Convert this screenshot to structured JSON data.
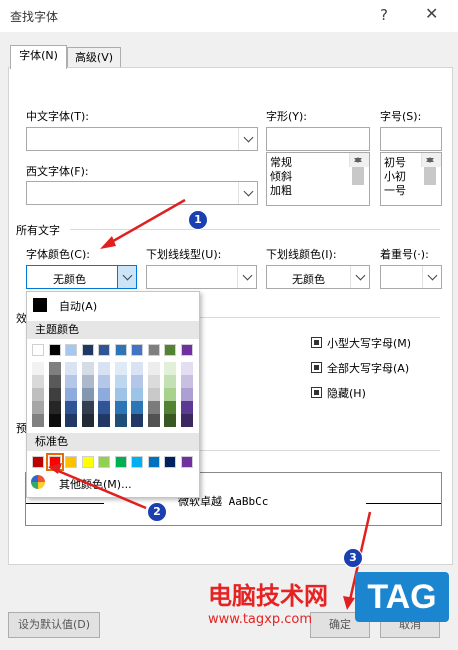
{
  "window": {
    "title": "查找字体",
    "help": "?",
    "close": "✕"
  },
  "tabs": [
    {
      "label": "字体(N)"
    },
    {
      "label": "高级(V)"
    }
  ],
  "font": {
    "chinese_label": "中文字体(T):",
    "western_label": "西文字体(F):",
    "style_label": "字形(Y):",
    "size_label": "字号(S):",
    "style_options": [
      "常规",
      "倾斜",
      "加粗"
    ],
    "size_options": [
      "初号",
      "小初",
      "一号"
    ]
  },
  "all_text": {
    "section": "所有文字",
    "font_color_label": "字体颜色(C):",
    "font_color_value": "无颜色",
    "underline_type_label": "下划线线型(U):",
    "underline_color_label": "下划线颜色(I):",
    "underline_color_value": "无颜色",
    "emphasis_label": "着重号(·):"
  },
  "effects": {
    "section_partial": "效",
    "small_caps": "小型大写字母(M)",
    "all_caps": "全部大写字母(A)",
    "hidden": "隐藏(H)"
  },
  "preview": {
    "section_partial": "预",
    "text": "微软卓越  AaBbCc"
  },
  "color_popup": {
    "auto": "自动(A)",
    "theme_header": "主题颜色",
    "standard_header": "标准色",
    "more_colors": "其他颜色(M)...",
    "theme_top": [
      "#ffffff",
      "#000000",
      "#e7e6e6",
      "#44546a",
      "#4472c4",
      "#ed7d31",
      "#a5a5a5",
      "#ffc000",
      "#5b9bd5",
      "#70ad47"
    ],
    "theme_top_alt": [
      "#ffffff",
      "#000000",
      "#a6c8f0",
      "#1f3864",
      "#2f5597",
      "#2e75b6",
      "#4472c4",
      "#7f7f7f",
      "#548235",
      "#7030a0"
    ],
    "shade_columns": [
      [
        "#f2f2f2",
        "#d9d9d9",
        "#bfbfbf",
        "#a6a6a6",
        "#808080"
      ],
      [
        "#7f7f7f",
        "#595959",
        "#3f3f3f",
        "#262626",
        "#0d0d0d"
      ],
      [
        "#dae3f3",
        "#b4c7e7",
        "#8faadc",
        "#2f5597",
        "#203864"
      ],
      [
        "#d6dce5",
        "#adb9ca",
        "#8497b0",
        "#333f50",
        "#222a35"
      ],
      [
        "#d9e2f3",
        "#b4c7e7",
        "#8faadc",
        "#2f5597",
        "#1f3864"
      ],
      [
        "#deebf7",
        "#bdd7ee",
        "#9dc3e6",
        "#2e75b6",
        "#1f4e79"
      ],
      [
        "#dae3f3",
        "#b4c7e7",
        "#9dc3e6",
        "#2e75b6",
        "#203864"
      ],
      [
        "#ededed",
        "#dbdbdb",
        "#c9c9c9",
        "#7b7b7b",
        "#525252"
      ],
      [
        "#e2f0d9",
        "#c5e0b4",
        "#a9d18e",
        "#548235",
        "#385723"
      ],
      [
        "#e4dff0",
        "#c9bfe0",
        "#ad9fd1",
        "#5c3a94",
        "#3c2761"
      ]
    ],
    "standard": [
      "#c00000",
      "#ff0000",
      "#ffc000",
      "#ffff00",
      "#92d050",
      "#00b050",
      "#00b0f0",
      "#0070c0",
      "#002060",
      "#7030a0"
    ]
  },
  "buttons": {
    "set_default": "设为默认值(D)",
    "ok_partial": "确定",
    "cancel_partial": "取消"
  },
  "annotations": [
    "1",
    "2",
    "3"
  ],
  "watermark": {
    "site_cn": "电脑技术网",
    "site_url": "www.tagxp.com",
    "logo": "TAG"
  }
}
